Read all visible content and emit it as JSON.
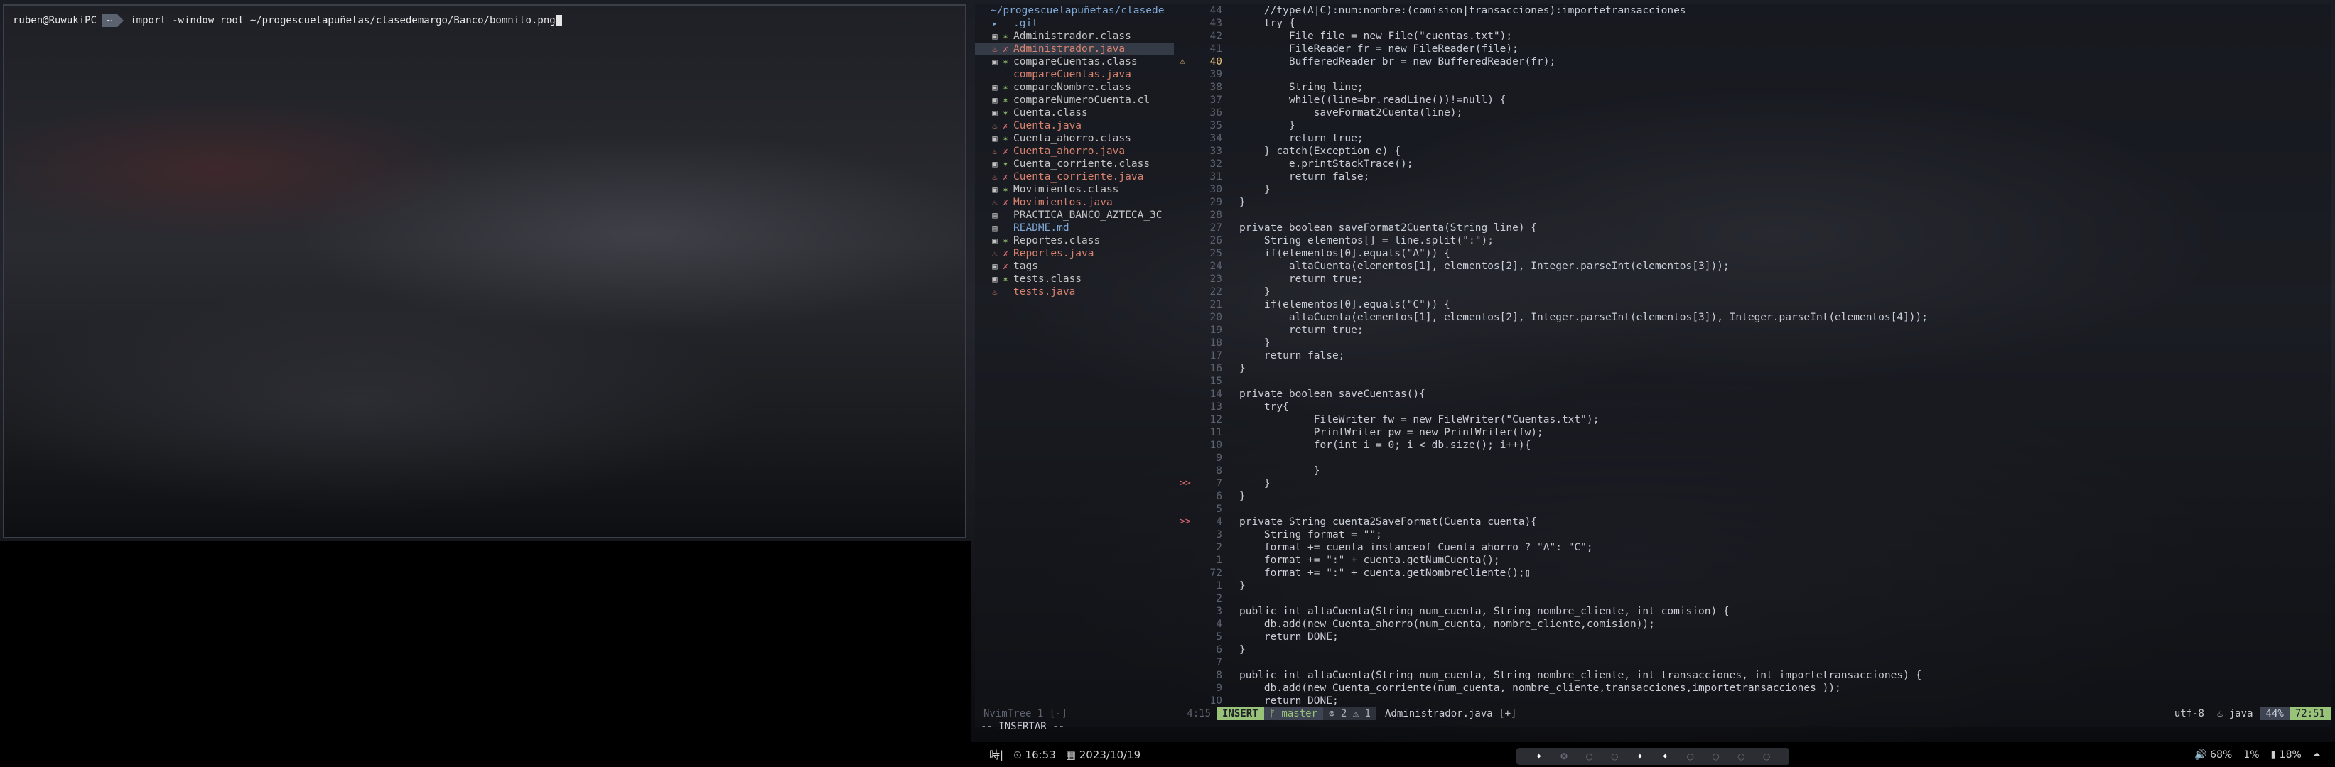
{
  "terminal": {
    "user_host": "ruben@RuwukiPC",
    "segment": "~",
    "command": "import -window root ~/progescuelapuñetas/clasedemargo/Banco/bomnito.png"
  },
  "tree": {
    "path": "~/progescuelapuñetas/clasede",
    "items": [
      {
        "icon": "▸",
        "sym": "",
        "name": ".git",
        "type": "dir"
      },
      {
        "icon": "▣",
        "sym": "✶",
        "name": "Administrador.class",
        "type": "class"
      },
      {
        "icon": "♨",
        "sym": "✗",
        "name": "Administrador.java",
        "type": "java"
      },
      {
        "icon": "▣",
        "sym": "✶",
        "name": "compareCuentas.class",
        "type": "class"
      },
      {
        "icon": "",
        "sym": "",
        "name": "compareCuentas.java",
        "type": "java"
      },
      {
        "icon": "▣",
        "sym": "✶",
        "name": "compareNombre.class",
        "type": "class"
      },
      {
        "icon": "▣",
        "sym": "✶",
        "name": "compareNumeroCuenta.cl",
        "type": "class"
      },
      {
        "icon": "▣",
        "sym": "✶",
        "name": "Cuenta.class",
        "type": "class"
      },
      {
        "icon": "♨",
        "sym": "✗",
        "name": "Cuenta.java",
        "type": "java"
      },
      {
        "icon": "▣",
        "sym": "✶",
        "name": "Cuenta_ahorro.class",
        "type": "class"
      },
      {
        "icon": "♨",
        "sym": "✗",
        "name": "Cuenta_ahorro.java",
        "type": "java"
      },
      {
        "icon": "▣",
        "sym": "✶",
        "name": "Cuenta_corriente.class",
        "type": "class"
      },
      {
        "icon": "♨",
        "sym": "✗",
        "name": "Cuenta_corriente.java",
        "type": "java"
      },
      {
        "icon": "▣",
        "sym": "✶",
        "name": "Movimientos.class",
        "type": "class"
      },
      {
        "icon": "♨",
        "sym": "✗",
        "name": "Movimientos.java",
        "type": "java"
      },
      {
        "icon": "▤",
        "sym": "",
        "name": "PRACTICA_BANCO_AZTECA_3C",
        "type": "plain"
      },
      {
        "icon": "▤",
        "sym": "",
        "name": "README.md",
        "type": "md"
      },
      {
        "icon": "▣",
        "sym": "✶",
        "name": "Reportes.class",
        "type": "class"
      },
      {
        "icon": "♨",
        "sym": "✗",
        "name": "Reportes.java",
        "type": "java"
      },
      {
        "icon": "▣",
        "sym": "✗",
        "name": "tags",
        "type": "class"
      },
      {
        "icon": "▣",
        "sym": "✶",
        "name": "tests.class",
        "type": "class"
      },
      {
        "icon": "♨",
        "sym": "",
        "name": "tests.java",
        "type": "java"
      }
    ]
  },
  "editor": {
    "lines": [
      {
        "sign": "",
        "num": "44",
        "text": "    //type(A|C):num:nombre:(comision|transacciones):importetransacciones"
      },
      {
        "sign": "",
        "num": "43",
        "text": "    try {"
      },
      {
        "sign": "",
        "num": "42",
        "text": "        File file = new File(\"cuentas.txt\");"
      },
      {
        "sign": "",
        "num": "41",
        "text": "        FileReader fr = new FileReader(file);"
      },
      {
        "sign": "⚠",
        "num": "40",
        "text": "        BufferedReader br = new BufferedReader(fr);",
        "cur": true
      },
      {
        "sign": "",
        "num": "39",
        "text": ""
      },
      {
        "sign": "",
        "num": "38",
        "text": "        String line;"
      },
      {
        "sign": "",
        "num": "37",
        "text": "        while((line=br.readLine())!=null) {"
      },
      {
        "sign": "",
        "num": "36",
        "text": "            saveFormat2Cuenta(line);"
      },
      {
        "sign": "",
        "num": "35",
        "text": "        }"
      },
      {
        "sign": "",
        "num": "34",
        "text": "        return true;"
      },
      {
        "sign": "",
        "num": "33",
        "text": "    } catch(Exception e) {"
      },
      {
        "sign": "",
        "num": "32",
        "text": "        e.printStackTrace();"
      },
      {
        "sign": "",
        "num": "31",
        "text": "        return false;"
      },
      {
        "sign": "",
        "num": "30",
        "text": "    }"
      },
      {
        "sign": "",
        "num": "29",
        "text": "}"
      },
      {
        "sign": "",
        "num": "28",
        "text": ""
      },
      {
        "sign": "",
        "num": "27",
        "text": "private boolean saveFormat2Cuenta(String line) {"
      },
      {
        "sign": "",
        "num": "26",
        "text": "    String elementos[] = line.split(\":\");"
      },
      {
        "sign": "",
        "num": "25",
        "text": "    if(elementos[0].equals(\"A\")) {"
      },
      {
        "sign": "",
        "num": "24",
        "text": "        altaCuenta(elementos[1], elementos[2], Integer.parseInt(elementos[3]));"
      },
      {
        "sign": "",
        "num": "23",
        "text": "        return true;"
      },
      {
        "sign": "",
        "num": "22",
        "text": "    }"
      },
      {
        "sign": "",
        "num": "21",
        "text": "    if(elementos[0].equals(\"C\")) {"
      },
      {
        "sign": "",
        "num": "20",
        "text": "        altaCuenta(elementos[1], elementos[2], Integer.parseInt(elementos[3]), Integer.parseInt(elementos[4]));"
      },
      {
        "sign": "",
        "num": "19",
        "text": "        return true;"
      },
      {
        "sign": "",
        "num": "18",
        "text": "    }"
      },
      {
        "sign": "",
        "num": "17",
        "text": "    return false;"
      },
      {
        "sign": "",
        "num": "16",
        "text": "}"
      },
      {
        "sign": "",
        "num": "15",
        "text": ""
      },
      {
        "sign": "",
        "num": "14",
        "text": "private boolean saveCuentas(){"
      },
      {
        "sign": "",
        "num": "13",
        "text": "    try{"
      },
      {
        "sign": "",
        "num": "12",
        "text": "            FileWriter fw = new FileWriter(\"Cuentas.txt\");"
      },
      {
        "sign": "",
        "num": "11",
        "text": "            PrintWriter pw = new PrintWriter(fw);"
      },
      {
        "sign": "",
        "num": "10",
        "text": "            for(int i = 0; i < db.size(); i++){"
      },
      {
        "sign": "",
        "num": "9",
        "text": ""
      },
      {
        "sign": "",
        "num": "8",
        "text": "            }"
      },
      {
        "sign": ">>",
        "num": "7",
        "text": "    }"
      },
      {
        "sign": "",
        "num": "6",
        "text": "}"
      },
      {
        "sign": "",
        "num": "5",
        "text": ""
      },
      {
        "sign": ">>",
        "num": "4",
        "text": "private String cuenta2SaveFormat(Cuenta cuenta){"
      },
      {
        "sign": "",
        "num": "3",
        "text": "    String format = \"\";"
      },
      {
        "sign": "",
        "num": "2",
        "text": "    format += cuenta instanceof Cuenta_ahorro ? \"A\": \"C\";"
      },
      {
        "sign": "",
        "num": "1",
        "text": "    format += \":\" + cuenta.getNumCuenta();"
      },
      {
        "sign": "",
        "num": "72",
        "text": "    format += \":\" + cuenta.getNombreCliente();▯"
      },
      {
        "sign": "",
        "num": "1",
        "text": "}"
      },
      {
        "sign": "",
        "num": "2",
        "text": ""
      },
      {
        "sign": "",
        "num": "3",
        "text": "public int altaCuenta(String num_cuenta, String nombre_cliente, int comision) {"
      },
      {
        "sign": "",
        "num": "4",
        "text": "    db.add(new Cuenta_ahorro(num_cuenta, nombre_cliente,comision));"
      },
      {
        "sign": "",
        "num": "5",
        "text": "    return DONE;"
      },
      {
        "sign": "",
        "num": "6",
        "text": "}"
      },
      {
        "sign": "",
        "num": "7",
        "text": ""
      },
      {
        "sign": "",
        "num": "8",
        "text": "public int altaCuenta(String num_cuenta, String nombre_cliente, int transacciones, int importetransacciones) {"
      },
      {
        "sign": "",
        "num": "9",
        "text": "    db.add(new Cuenta_corriente(num_cuenta, nombre_cliente,transacciones,importetransacciones ));"
      },
      {
        "sign": "",
        "num": "10",
        "text": "    return DONE;"
      }
    ]
  },
  "statusline": {
    "tree_label": "NvimTree_1 [-]",
    "pos": "4:15",
    "mode": "INSERT",
    "branch": "ᚠ master",
    "diag": "⊗ 2 ⚠ 1",
    "file": "Administrador.java [+]",
    "encoding": "utf-8",
    "filetype": "♨ java",
    "percent": "44%",
    "linecol": "72:51"
  },
  "cmdline": "-- INSERTAR --",
  "bar": {
    "layout": "時|",
    "time": "⏲ 16:53",
    "date": "▦ 2023/10/19",
    "workspaces": [
      "✦",
      "❂",
      "○",
      "○",
      "✦",
      "✦",
      "○",
      "○",
      "○",
      "○"
    ],
    "active_ws": [
      0,
      4,
      5
    ],
    "volume": "🔊 68%",
    "brightness": "1%",
    "battery": "▮ 18%",
    "arrow": "⏶"
  }
}
